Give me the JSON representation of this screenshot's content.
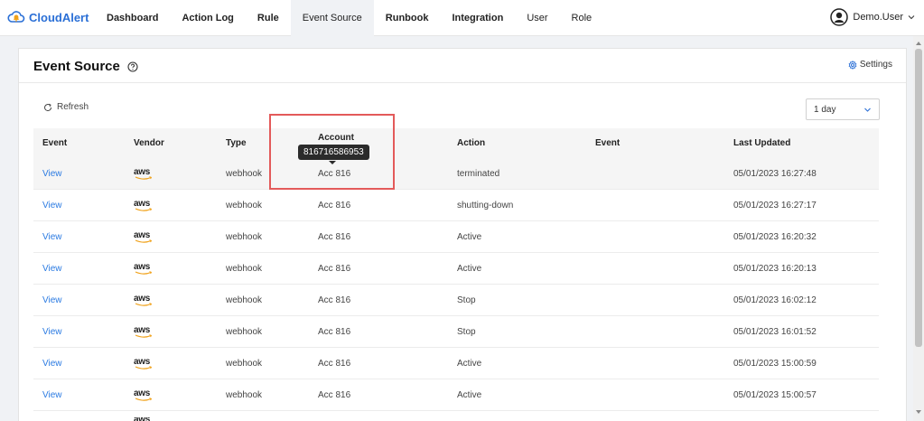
{
  "app": {
    "name": "CloudAlert",
    "brand_color": "#2a6fd6"
  },
  "nav": [
    {
      "label": "Dashboard",
      "bold": true,
      "active": false
    },
    {
      "label": "Action Log",
      "bold": true,
      "active": false
    },
    {
      "label": "Rule",
      "bold": true,
      "active": false
    },
    {
      "label": "Event Source",
      "bold": false,
      "active": true
    },
    {
      "label": "Runbook",
      "bold": true,
      "active": false
    },
    {
      "label": "Integration",
      "bold": true,
      "active": false
    },
    {
      "label": "User",
      "bold": false,
      "active": false
    },
    {
      "label": "Role",
      "bold": false,
      "active": false
    }
  ],
  "user": {
    "name": "Demo.User",
    "avatar_icon": "user-avatar-icon",
    "chevron_icon": "chevron-down-icon"
  },
  "page": {
    "title": "Event Source",
    "help_icon": "question-circle-icon",
    "settings_label": "Settings",
    "settings_icon": "gear-icon",
    "refresh_label": "Refresh",
    "refresh_icon": "refresh-icon",
    "range_value": "1 day"
  },
  "table": {
    "columns": [
      "Event",
      "Vendor",
      "Type",
      "Account",
      "Action",
      "Event",
      "Last Updated"
    ],
    "rows": [
      {
        "link": "View",
        "vendor": "aws",
        "type": "webhook",
        "account": "Acc 816",
        "action": "terminated",
        "event": "",
        "updated": "05/01/2023 16:27:48"
      },
      {
        "link": "View",
        "vendor": "aws",
        "type": "webhook",
        "account": "Acc 816",
        "action": "shutting-down",
        "event": "",
        "updated": "05/01/2023 16:27:17"
      },
      {
        "link": "View",
        "vendor": "aws",
        "type": "webhook",
        "account": "Acc 816",
        "action": "Active",
        "event": "",
        "updated": "05/01/2023 16:20:32"
      },
      {
        "link": "View",
        "vendor": "aws",
        "type": "webhook",
        "account": "Acc 816",
        "action": "Active",
        "event": "",
        "updated": "05/01/2023 16:20:13"
      },
      {
        "link": "View",
        "vendor": "aws",
        "type": "webhook",
        "account": "Acc 816",
        "action": "Stop",
        "event": "",
        "updated": "05/01/2023 16:02:12"
      },
      {
        "link": "View",
        "vendor": "aws",
        "type": "webhook",
        "account": "Acc 816",
        "action": "Stop",
        "event": "",
        "updated": "05/01/2023 16:01:52"
      },
      {
        "link": "View",
        "vendor": "aws",
        "type": "webhook",
        "account": "Acc 816",
        "action": "Active",
        "event": "",
        "updated": "05/01/2023 15:00:59"
      },
      {
        "link": "View",
        "vendor": "aws",
        "type": "webhook",
        "account": "Acc 816",
        "action": "Active",
        "event": "",
        "updated": "05/01/2023 15:00:57"
      }
    ],
    "partial_vendor": "aws"
  },
  "tooltip": {
    "text": "816716586953"
  },
  "colors": {
    "link": "#2a7ae2",
    "highlight": "#e35a5a",
    "tooltip_bg": "#2b2b2b"
  }
}
